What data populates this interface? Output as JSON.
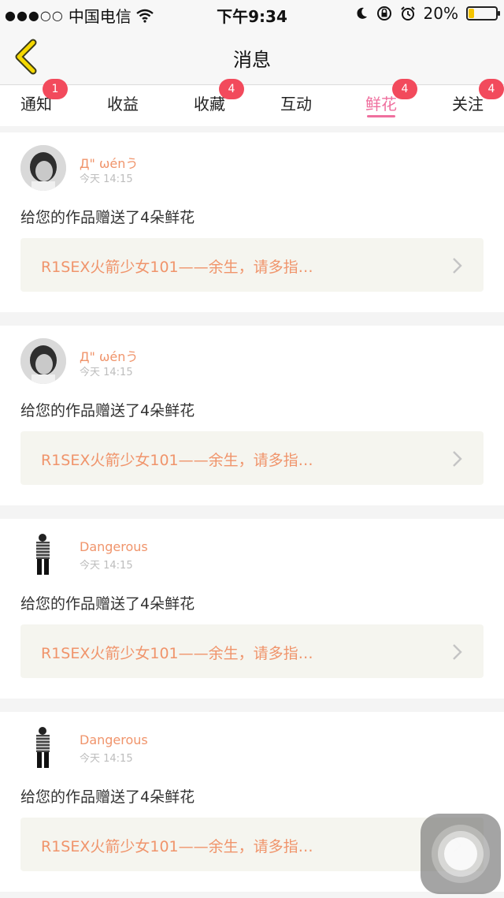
{
  "status_bar": {
    "carrier": "中国电信",
    "time": "下午9:34",
    "battery": "20%",
    "battery_level": 0.2
  },
  "nav": {
    "title": "消息"
  },
  "tabs": [
    {
      "label": "通知",
      "badge": "1",
      "active": false
    },
    {
      "label": "收益",
      "badge": "",
      "active": false
    },
    {
      "label": "收藏",
      "badge": "4",
      "active": false
    },
    {
      "label": "互动",
      "badge": "",
      "active": false
    },
    {
      "label": "鲜花",
      "badge": "4",
      "active": true
    },
    {
      "label": "关注",
      "badge": "4",
      "active": false
    }
  ],
  "messages": [
    {
      "user": "Д\" ωénう",
      "time": "今天 14:15",
      "text": "给您的作品赠送了4朵鲜花",
      "work": "R1SEX火箭少女101——余生，请多指…",
      "avatar": "portrait-avatar"
    },
    {
      "user": "Д\" ωénう",
      "time": "今天 14:15",
      "text": "给您的作品赠送了4朵鲜花",
      "work": "R1SEX火箭少女101——余生，请多指…",
      "avatar": "portrait-avatar"
    },
    {
      "user": "Dangerous",
      "time": "今天 14:15",
      "text": "给您的作品赠送了4朵鲜花",
      "work": "R1SEX火箭少女101——余生，请多指…",
      "avatar": "figure-avatar"
    },
    {
      "user": "Dangerous",
      "time": "今天 14:15",
      "text": "给您的作品赠送了4朵鲜花",
      "work": "R1SEX火箭少女101——余生，请多指…",
      "avatar": "figure-avatar"
    }
  ],
  "colors": {
    "accent_pink": "#ef6f9e",
    "badge_red": "#f24a5c",
    "name_orange": "#f0946b",
    "link_bg": "#f5f5ef"
  }
}
